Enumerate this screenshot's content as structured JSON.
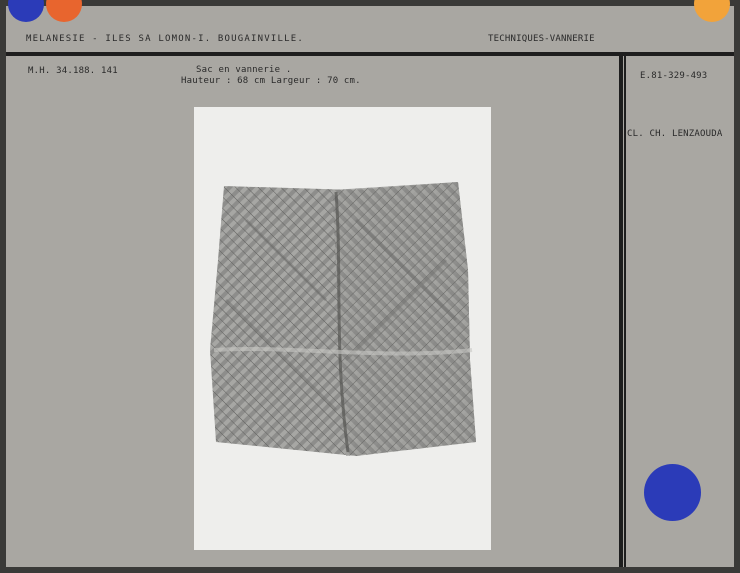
{
  "header": {
    "region": "MELANESIE - ILES SA LOMON-I. BOUGAINVILLE.",
    "category": "TECHNIQUES-VANNERIE"
  },
  "record": {
    "inventory_number": "M.H. 34.188. 141",
    "title": "Sac en vannerie .",
    "dimensions": "Hauteur : 68 cm Largeur : 70 cm."
  },
  "sidebar": {
    "photo_number": "E.81-329-493",
    "photographer": "CL. CH. LENZAOUDA"
  },
  "colors": {
    "card": "#a9a7a2",
    "blue_dot": "#2b3bb8",
    "orange_dot": "#e8652e",
    "yellow_dot": "#f2a33a"
  },
  "icons": [
    "blue-dot-icon",
    "orange-dot-icon",
    "yellow-dot-icon",
    "blue-dot-icon"
  ]
}
